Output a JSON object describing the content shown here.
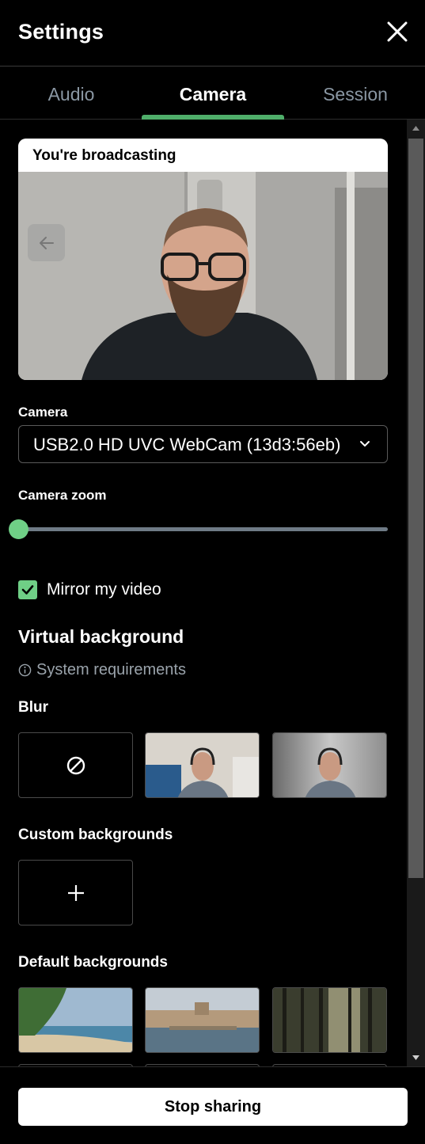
{
  "header": {
    "title": "Settings",
    "close_icon": "close-icon"
  },
  "tabs": [
    {
      "label": "Audio",
      "active": false
    },
    {
      "label": "Camera",
      "active": true
    },
    {
      "label": "Session",
      "active": false
    }
  ],
  "accent_color": "#4fae6a",
  "preview": {
    "status": "You're broadcasting",
    "prev_icon": "arrow-left-icon"
  },
  "camera": {
    "label": "Camera",
    "selected": "USB2.0 HD UVC WebCam (13d3:56eb)"
  },
  "zoom": {
    "label": "Camera zoom",
    "value": 0
  },
  "mirror": {
    "label": "Mirror my video",
    "checked": true
  },
  "virtual_background": {
    "title": "Virtual background",
    "system_requirements": "System requirements",
    "blur": {
      "title": "Blur",
      "options": [
        "none",
        "light-blur",
        "strong-blur"
      ]
    },
    "custom": {
      "title": "Custom backgrounds"
    },
    "default": {
      "title": "Default backgrounds",
      "options": [
        "beach",
        "city-bridge",
        "forest"
      ]
    }
  },
  "footer": {
    "stop_label": "Stop sharing"
  }
}
